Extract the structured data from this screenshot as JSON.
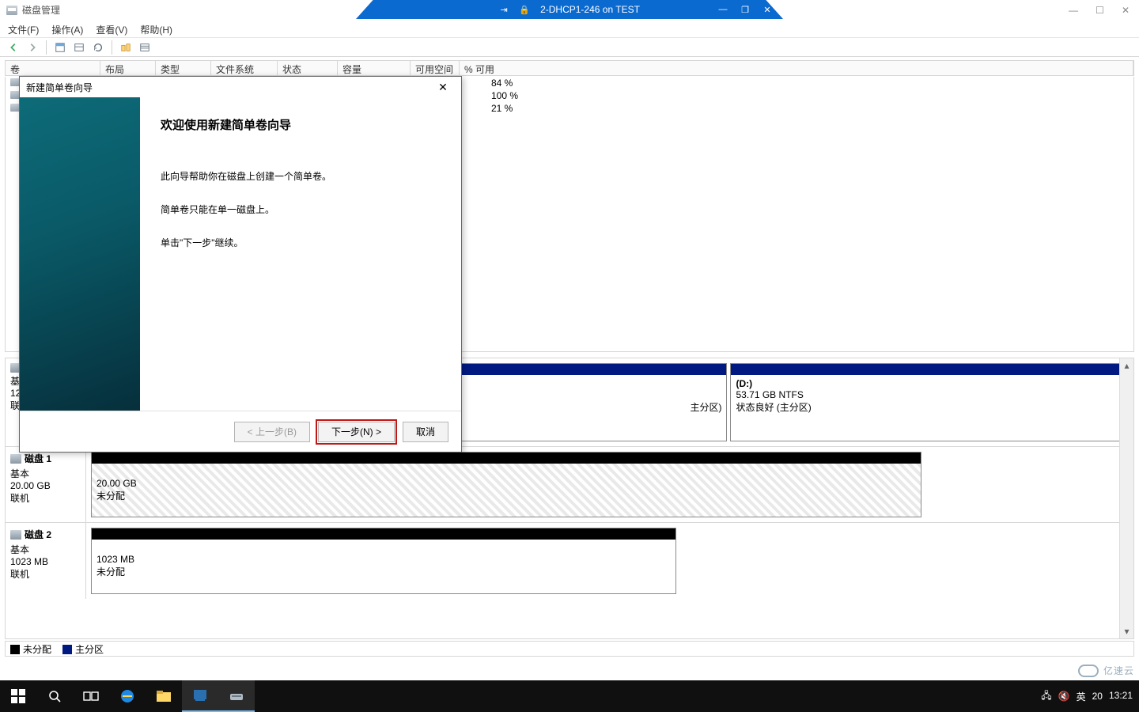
{
  "os_controls": {
    "min": "—",
    "max": "☐",
    "close": "✕"
  },
  "conn_bar": {
    "title": "2-DHCP1-246 on TEST",
    "pin": "⇥",
    "lock": "🔒",
    "min": "—",
    "restore": "❐",
    "close": "✕"
  },
  "dm": {
    "title": "磁盘管理"
  },
  "menu": {
    "file": "文件(F)",
    "action": "操作(A)",
    "view": "查看(V)",
    "help": "帮助(H)"
  },
  "columns": {
    "volume": "卷",
    "layout": "布局",
    "type": "类型",
    "fs": "文件系统",
    "status": "状态",
    "capacity": "容量",
    "free": "可用空间",
    "pct": "% 可用"
  },
  "vol_rows": {
    "r1_pct": "84 %",
    "r2_pct": "100 %",
    "r3_pct": "21 %"
  },
  "disk0": {
    "type": "基本",
    "size": "12",
    "status": "联",
    "part_right_label": "(D:)",
    "part_right_size": "53.71 GB NTFS",
    "part_right_status": "状态良好 (主分区)",
    "part_left_status_tail": "主分区)"
  },
  "disk1": {
    "name": "磁盘 1",
    "type": "基本",
    "size": "20.00 GB",
    "status": "联机",
    "part_size": "20.00 GB",
    "part_status": "未分配"
  },
  "disk2": {
    "name": "磁盘 2",
    "type": "基本",
    "size": "1023 MB",
    "status": "联机",
    "part_size": "1023 MB",
    "part_status": "未分配"
  },
  "legend": {
    "unalloc": "未分配",
    "primary": "主分区"
  },
  "wizard": {
    "title": "新建简单卷向导",
    "heading": "欢迎使用新建简单卷向导",
    "p1": "此向导帮助你在磁盘上创建一个简单卷。",
    "p2": "简单卷只能在单一磁盘上。",
    "p3": "单击\"下一步\"继续。",
    "back": "< 上一步(B)",
    "next": "下一步(N) >",
    "cancel": "取消",
    "close_x": "✕"
  },
  "tray": {
    "ime": "英",
    "ime2": "20",
    "time": "13:21"
  },
  "watermark": "亿速云"
}
